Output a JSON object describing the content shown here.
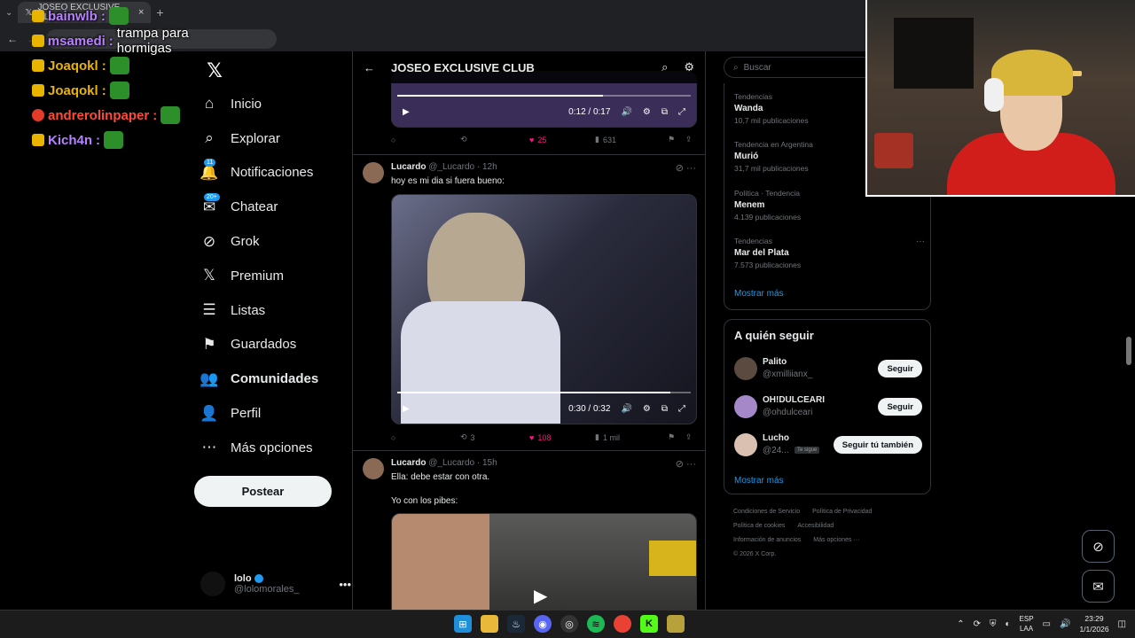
{
  "browser": {
    "tab_title": "JOSEO EXCLUSIVE CLU",
    "tab_close": "×",
    "new_tab": "+",
    "back": "←"
  },
  "chat": [
    {
      "user": "bainwlb",
      "color": "#b882ff",
      "message": ""
    },
    {
      "user": "msamedi",
      "color": "#b882ff",
      "message": "trampa para hormigas"
    },
    {
      "user": "Joaqokl",
      "color": "#e8b400",
      "message": ""
    },
    {
      "user": "Joaqokl",
      "color": "#e8b400",
      "message": ""
    },
    {
      "user": "andrerolinpaper",
      "color": "#ff4a3a",
      "message": ""
    },
    {
      "user": "Kich4n",
      "color": "#b882ff",
      "message": ""
    }
  ],
  "sidebar": {
    "logo": "𝕏",
    "items": [
      {
        "label": "Inicio",
        "icon": "home-icon",
        "glyph": "⌂",
        "badge": ""
      },
      {
        "label": "Explorar",
        "icon": "search-icon",
        "glyph": "⌕",
        "badge": ""
      },
      {
        "label": "Notificaciones",
        "icon": "bell-icon",
        "glyph": "🔔",
        "badge": "11"
      },
      {
        "label": "Chatear",
        "icon": "chat-icon",
        "glyph": "✉",
        "badge": "20+"
      },
      {
        "label": "Grok",
        "icon": "grok-icon",
        "glyph": "⊘",
        "badge": ""
      },
      {
        "label": "Premium",
        "icon": "x-premium-icon",
        "glyph": "𝕏",
        "badge": ""
      },
      {
        "label": "Listas",
        "icon": "list-icon",
        "glyph": "☰",
        "badge": ""
      },
      {
        "label": "Guardados",
        "icon": "bookmark-icon",
        "glyph": "⚑",
        "badge": ""
      },
      {
        "label": "Comunidades",
        "icon": "communities-icon",
        "glyph": "👥",
        "badge": ""
      },
      {
        "label": "Perfil",
        "icon": "profile-icon",
        "glyph": "👤",
        "badge": ""
      },
      {
        "label": "Más opciones",
        "icon": "more-icon",
        "glyph": "⋯",
        "badge": ""
      }
    ],
    "post_button": "Postear",
    "user": {
      "name": "lolo",
      "handle": "@lolomorales_",
      "more": "•••"
    }
  },
  "feed": {
    "title": "JOSEO EXCLUSIVE CLUB",
    "first_video": {
      "time": "0:12 / 0:17",
      "progress": 0.7
    },
    "first_actions": {
      "replies": "",
      "reposts": "",
      "likes": "25",
      "views": "631"
    },
    "tweets": [
      {
        "author": "Lucardo",
        "handle": "@_Lucardo",
        "time": "12h",
        "text": "hoy es mi dia si fuera bueno:",
        "video_time": "0:30 / 0:32",
        "progress": 0.93,
        "replies": "",
        "reposts": "3",
        "likes": "108",
        "views": "1 mil"
      },
      {
        "author": "Lucardo",
        "handle": "@_Lucardo",
        "time": "15h",
        "text": "Ella: debe estar con otra.",
        "text2": "Yo con los pibes:"
      }
    ]
  },
  "right": {
    "search_placeholder": "Buscar",
    "trends": [
      {
        "context": "Tendencias",
        "name": "Wanda",
        "count": "10,7 mil publicaciones"
      },
      {
        "context": "Tendencia en Argentina",
        "name": "Murió",
        "count": "31,7 mil publicaciones"
      },
      {
        "context": "Política · Tendencia",
        "name": "Menem",
        "count": "4.139 publicaciones"
      },
      {
        "context": "Tendencias",
        "name": "Mar del Plata",
        "count": "7.573 publicaciones"
      }
    ],
    "show_more": "Mostrar más",
    "who_to_follow": {
      "title": "A quién seguir",
      "users": [
        {
          "name": "Palito",
          "handle": "@xmilliianx_",
          "button": "Seguir",
          "follows_you": ""
        },
        {
          "name": "OH!DULCEARI",
          "handle": "@ohdulceari",
          "button": "Seguir",
          "follows_you": ""
        },
        {
          "name": "Lucho",
          "handle": "@24...",
          "button": "Seguir tú también",
          "follows_you": "Te sigue"
        }
      ],
      "show_more": "Mostrar más"
    },
    "footer": [
      "Condiciones de Servicio",
      "Política de Privacidad",
      "Política de cookies",
      "Accesibilidad",
      "Información de anuncios",
      "Más opciones ···",
      "© 2026 X Corp."
    ]
  },
  "taskbar": {
    "lang_top": "ESP",
    "lang_bottom": "LAA",
    "time": "23:29",
    "date": "1/1/2026"
  },
  "colors": {
    "accent": "#1d9bf0",
    "like": "#f91880",
    "background": "#000000"
  }
}
